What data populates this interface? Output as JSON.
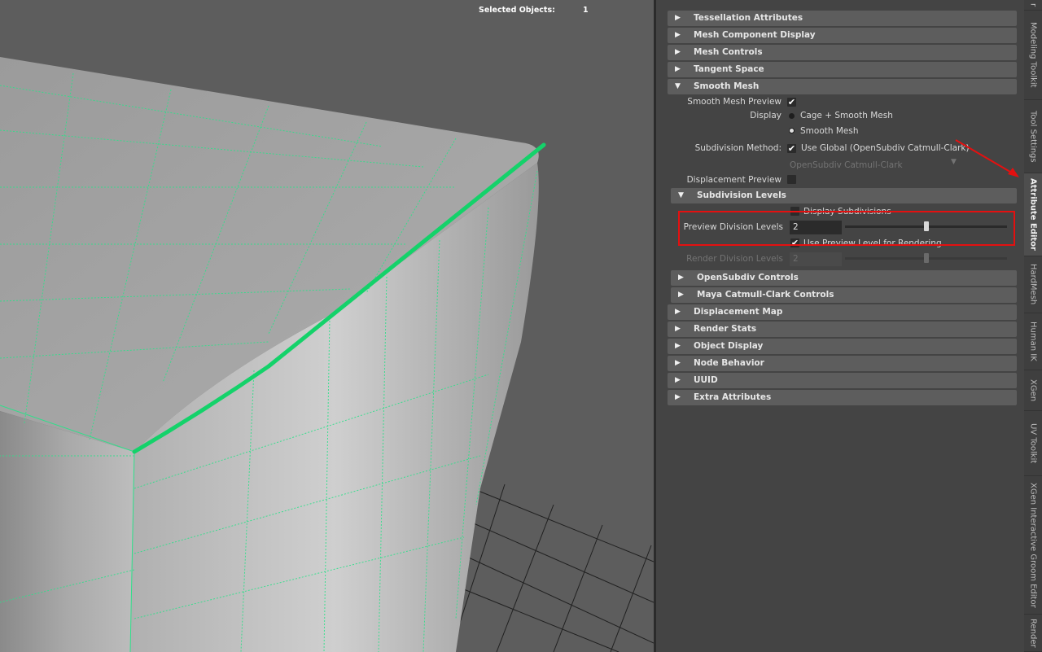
{
  "viewport": {
    "hud_label": "Selected Objects:",
    "hud_value": "1"
  },
  "sections": {
    "tessellation": "Tessellation Attributes",
    "mesh_component_display": "Mesh Component Display",
    "mesh_controls": "Mesh Controls",
    "tangent_space": "Tangent Space",
    "smooth_mesh": "Smooth Mesh",
    "subdivision_levels": "Subdivision Levels",
    "opensubdiv_controls": "OpenSubdiv Controls",
    "maya_catmull_clark": "Maya Catmull-Clark Controls",
    "displacement_map": "Displacement Map",
    "render_stats": "Render Stats",
    "object_display": "Object Display",
    "node_behavior": "Node Behavior",
    "uuid": "UUID",
    "extra_attributes": "Extra Attributes"
  },
  "smooth_mesh": {
    "preview_label": "Smooth Mesh Preview",
    "preview_checked": "✔",
    "display_label": "Display",
    "display_option_1": "Cage + Smooth Mesh",
    "display_option_2": "Smooth Mesh",
    "subdiv_method_label": "Subdivision Method:",
    "use_global_check": "✔",
    "use_global_label": "Use Global (OpenSubdiv Catmull-Clark)",
    "method_dropdown": "OpenSubdiv Catmull-Clark",
    "displacement_preview_label": "Displacement Preview"
  },
  "subdivision_levels": {
    "display_subdivisions_label": "Display Subdivisions",
    "preview_division_label": "Preview Division Levels",
    "preview_division_value": "2",
    "preview_slider_fraction": 0.5,
    "use_preview_check": "✔",
    "use_preview_label": "Use Preview Level for Rendering",
    "render_division_label": "Render Division Levels",
    "render_division_value": "2"
  },
  "tabs": [
    "Modeling Toolkit",
    "Tool Settings",
    "Attribute Editor",
    "HardMesh",
    "Human IK",
    "XGen",
    "UV Toolkit",
    "XGen Interactive Groom Editor",
    "Render"
  ],
  "colors": {
    "selected_edge": "#14d26a",
    "wire": "#2ee08a",
    "highlight": "#e41010"
  }
}
